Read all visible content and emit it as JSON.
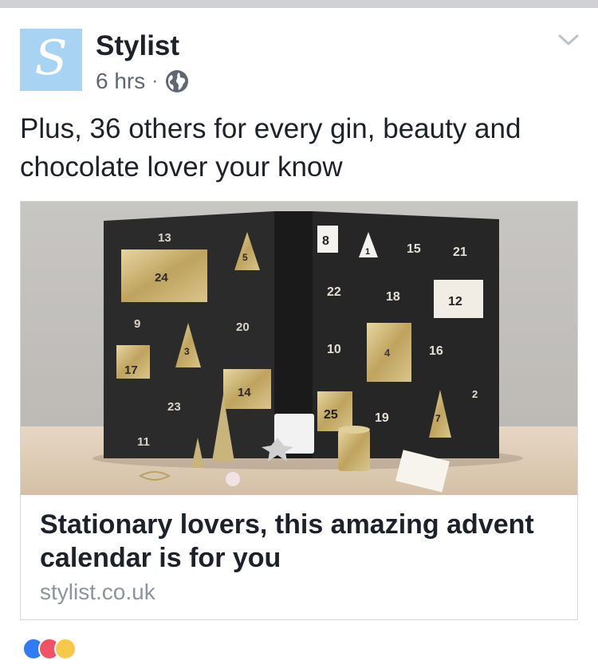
{
  "post": {
    "author": "Stylist",
    "avatar_letter": "S",
    "time": "6 hrs",
    "separator": "·",
    "privacy_icon": "globe-icon",
    "menu_icon": "chevron-down-icon",
    "text": "Plus, 36 others for every gin, beauty and chocolate lover your know"
  },
  "link_card": {
    "title": "Stationary lovers, this amazing advent calendar is for you",
    "domain": "stylist.co.uk",
    "image": {
      "left_page_numbers": [
        "13",
        "5",
        "24",
        "9",
        "20",
        "3",
        "17",
        "23",
        "14",
        "11"
      ],
      "right_page_numbers": [
        "8",
        "1",
        "15",
        "21",
        "22",
        "18",
        "12",
        "10",
        "4",
        "16",
        "2",
        "25",
        "19",
        "7"
      ]
    }
  },
  "colors": {
    "avatar_bg": "#a9d3f2",
    "text_primary": "#1d2129",
    "text_secondary": "#606770",
    "domain_gray": "#8d949e"
  }
}
